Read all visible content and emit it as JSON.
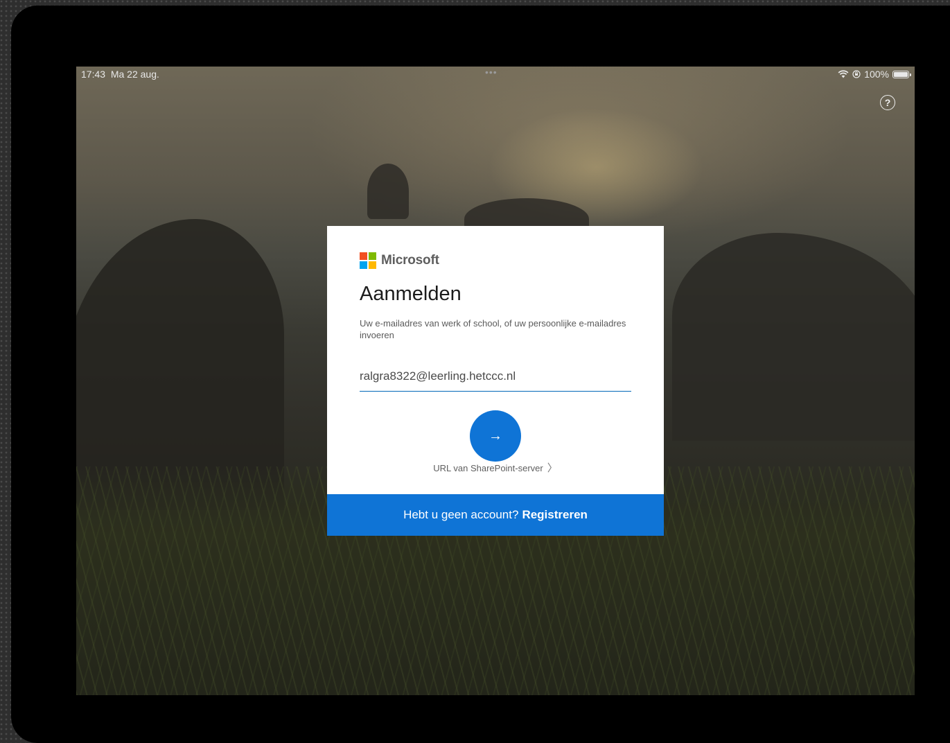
{
  "status_bar": {
    "time": "17:43",
    "date": "Ma 22 aug.",
    "dots": "•••",
    "wifi_icon": "wifi-icon",
    "lock_icon": "rotation-lock-icon",
    "battery_percent": "100%",
    "battery_level": 1.0
  },
  "help": {
    "label": "?"
  },
  "login_card": {
    "brand": "Microsoft",
    "brand_colors": [
      "#f25022",
      "#7fba00",
      "#00a4ef",
      "#ffb900"
    ],
    "title": "Aanmelden",
    "subtitle": "Uw e-mailadres van werk of school, of uw persoonlijke e-mailadres invoeren",
    "email_value": "ralgra8322@leerling.hetccc.nl",
    "next_icon": "→",
    "sharepoint_link": "URL van SharePoint-server",
    "sharepoint_chevron": "〉",
    "footer_text": "Hebt u geen account?",
    "footer_link": "Registreren",
    "accent_color": "#0f74d6"
  }
}
